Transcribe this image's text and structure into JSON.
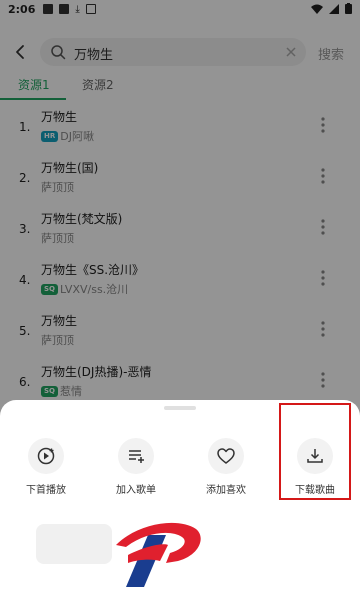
{
  "status_bar": {
    "time": "2:06"
  },
  "search": {
    "query": "万物生",
    "button": "搜索"
  },
  "tabs": [
    {
      "label": "资源1",
      "active": true
    },
    {
      "label": "资源2",
      "active": false
    }
  ],
  "songs": [
    {
      "num": "1.",
      "title": "万物生",
      "badge": "HR",
      "artist": "DJ阿啾"
    },
    {
      "num": "2.",
      "title": "万物生(国)",
      "badge": "",
      "artist": "萨顶顶"
    },
    {
      "num": "3.",
      "title": "万物生(梵文版)",
      "badge": "",
      "artist": "萨顶顶"
    },
    {
      "num": "4.",
      "title": "万物生《SS.沧川》",
      "badge": "SQ",
      "artist": "LVXV/ss.沧川"
    },
    {
      "num": "5.",
      "title": "万物生",
      "badge": "",
      "artist": "萨顶顶"
    },
    {
      "num": "6.",
      "title": "万物生(DJ热播)-恶情",
      "badge": "SQ",
      "artist": "惹情"
    }
  ],
  "sheet": {
    "actions": [
      {
        "label": "下首播放",
        "icon": "play-next-icon"
      },
      {
        "label": "加入歌单",
        "icon": "add-playlist-icon"
      },
      {
        "label": "添加喜欢",
        "icon": "heart-icon"
      },
      {
        "label": "下载歌曲",
        "icon": "download-icon"
      }
    ]
  },
  "colors": {
    "accent": "#21a663",
    "highlight": "#d41818",
    "hr_badge": "#16a3c2",
    "logo_red": "#e0202e",
    "logo_blue": "#1a3d8f"
  }
}
